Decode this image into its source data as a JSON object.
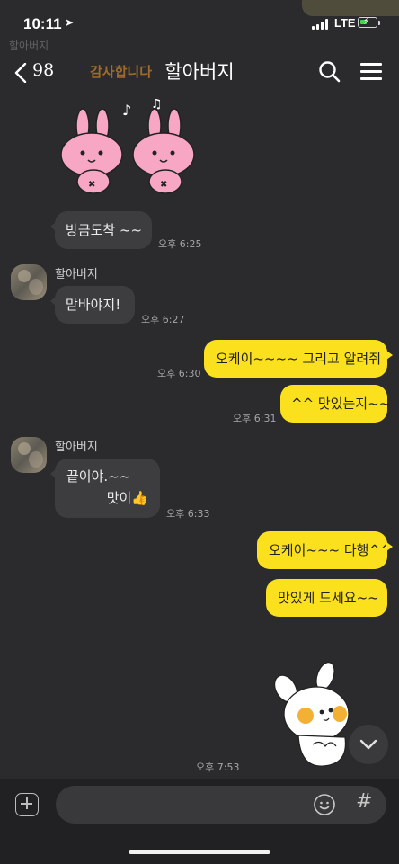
{
  "status_bar": {
    "time": "10:11",
    "network": "LTE"
  },
  "header": {
    "back_count": "98",
    "title": "할아버지",
    "overlay_text": "감사합니다",
    "overlay_sub": "할아버지"
  },
  "messages": {
    "m1": {
      "text": "방금도착 ~~",
      "time": "오후 6:25"
    },
    "m2": {
      "sender": "할아버지",
      "text": "맏바야지!",
      "time": "오후 6:27"
    },
    "m3": {
      "text": "오케이~~~~ 그리고 알려줘",
      "time": "오후 6:30"
    },
    "m4": {
      "text": "^^ 맛있는지~~",
      "time": "오후 6:31"
    },
    "m5": {
      "sender": "할아버지",
      "line1": "끝이야.~~",
      "line2": "맛이👍",
      "time": "오후 6:33"
    },
    "m6": {
      "text": "오케이~~~ 다행^^"
    },
    "m7": {
      "text": "맛있게 드세요~~"
    },
    "m8": {
      "time": "오후 7:53"
    }
  },
  "input": {
    "placeholder": "",
    "hash_label": "#"
  },
  "colors": {
    "background": "#2b2b2d",
    "incoming_bubble": "#3d3d40",
    "outgoing_bubble": "#fbe11d"
  }
}
